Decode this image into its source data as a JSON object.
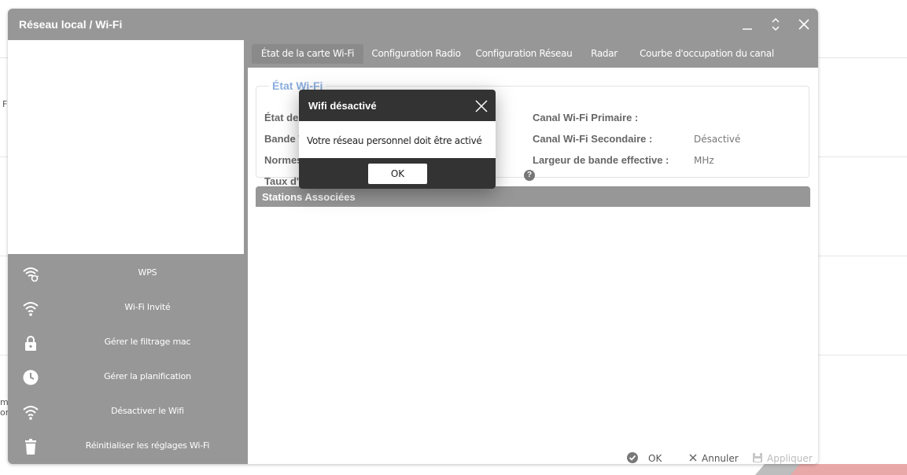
{
  "background": {
    "fragments": [
      "F",
      "m",
      "or"
    ]
  },
  "window": {
    "title": "Réseau local / Wi-Fi",
    "tabs": [
      {
        "label": "État de la carte Wi-Fi",
        "active": true
      },
      {
        "label": "Configuration Radio",
        "active": false
      },
      {
        "label": "Configuration Réseau",
        "active": false
      },
      {
        "label": "Radar",
        "active": false
      },
      {
        "label": "Courbe d'occupation du canal",
        "active": false
      }
    ],
    "side_menu": [
      {
        "label": "WPS",
        "icon": "wps-icon"
      },
      {
        "label": "Wi-Fi Invité",
        "icon": "wifi-icon"
      },
      {
        "label": "Gérer le filtrage mac",
        "icon": "lock-icon"
      },
      {
        "label": "Gérer la planification",
        "icon": "clock-icon"
      },
      {
        "label": "Désactiver le Wifi",
        "icon": "wifi-icon"
      },
      {
        "label": "Réinitialiser les réglages Wi-Fi",
        "icon": "trash-icon"
      }
    ],
    "wifi_state": {
      "legend": "État Wi-Fi",
      "left_labels": [
        "État de",
        "Bande W",
        "Normes",
        "Taux d'"
      ],
      "right_fields": [
        {
          "label": "Canal Wi-Fi Primaire :",
          "value": ""
        },
        {
          "label": "Canal Wi-Fi Secondaire :",
          "value": "Désactivé"
        },
        {
          "label": "Largeur de bande effective :",
          "value": "MHz"
        }
      ],
      "help": "?"
    },
    "stations_title": "Stations Associées",
    "footer": {
      "ok": "OK",
      "cancel": "Annuler",
      "apply": "Appliquer"
    }
  },
  "dialog": {
    "title": "Wifi désactivé",
    "message": "Votre réseau personnel doit être activé",
    "ok": "OK"
  },
  "colors": {
    "window_gray": "#979797",
    "dialog_dark": "#333333",
    "legend_blue": "#8aaede"
  }
}
